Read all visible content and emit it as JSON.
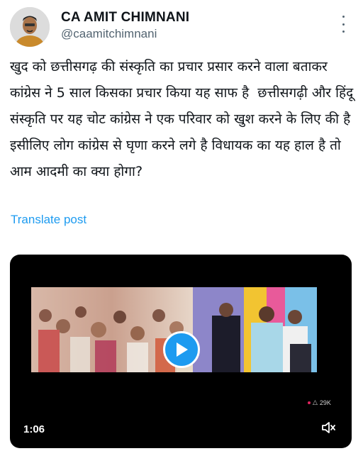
{
  "author": {
    "name": "CA AMIT CHIMNANI",
    "handle": "@caamitchimnani"
  },
  "post": {
    "text": "खुद को छत्तीसगढ़ की संस्कृति का प्रचार प्रसार करने वाला बताकर कांग्रेस ने 5 साल किसका प्रचार किया यह साफ है  छत्तीसगढ़ी और हिंदू संस्कृति पर यह चोट कांग्रेस ने एक परिवार को खुश करने के लिए की है इसीलिए लोग कांग्रेस से घृणा करने लगे है विधायक का यह हाल है तो आम आदमी का क्या होगा?",
    "translate_label": "Translate post"
  },
  "video": {
    "duration": "1:06",
    "overlay_views": "29K"
  },
  "colors": {
    "accent": "#1d9bf0",
    "text": "#0f1419",
    "muted": "#536471"
  }
}
